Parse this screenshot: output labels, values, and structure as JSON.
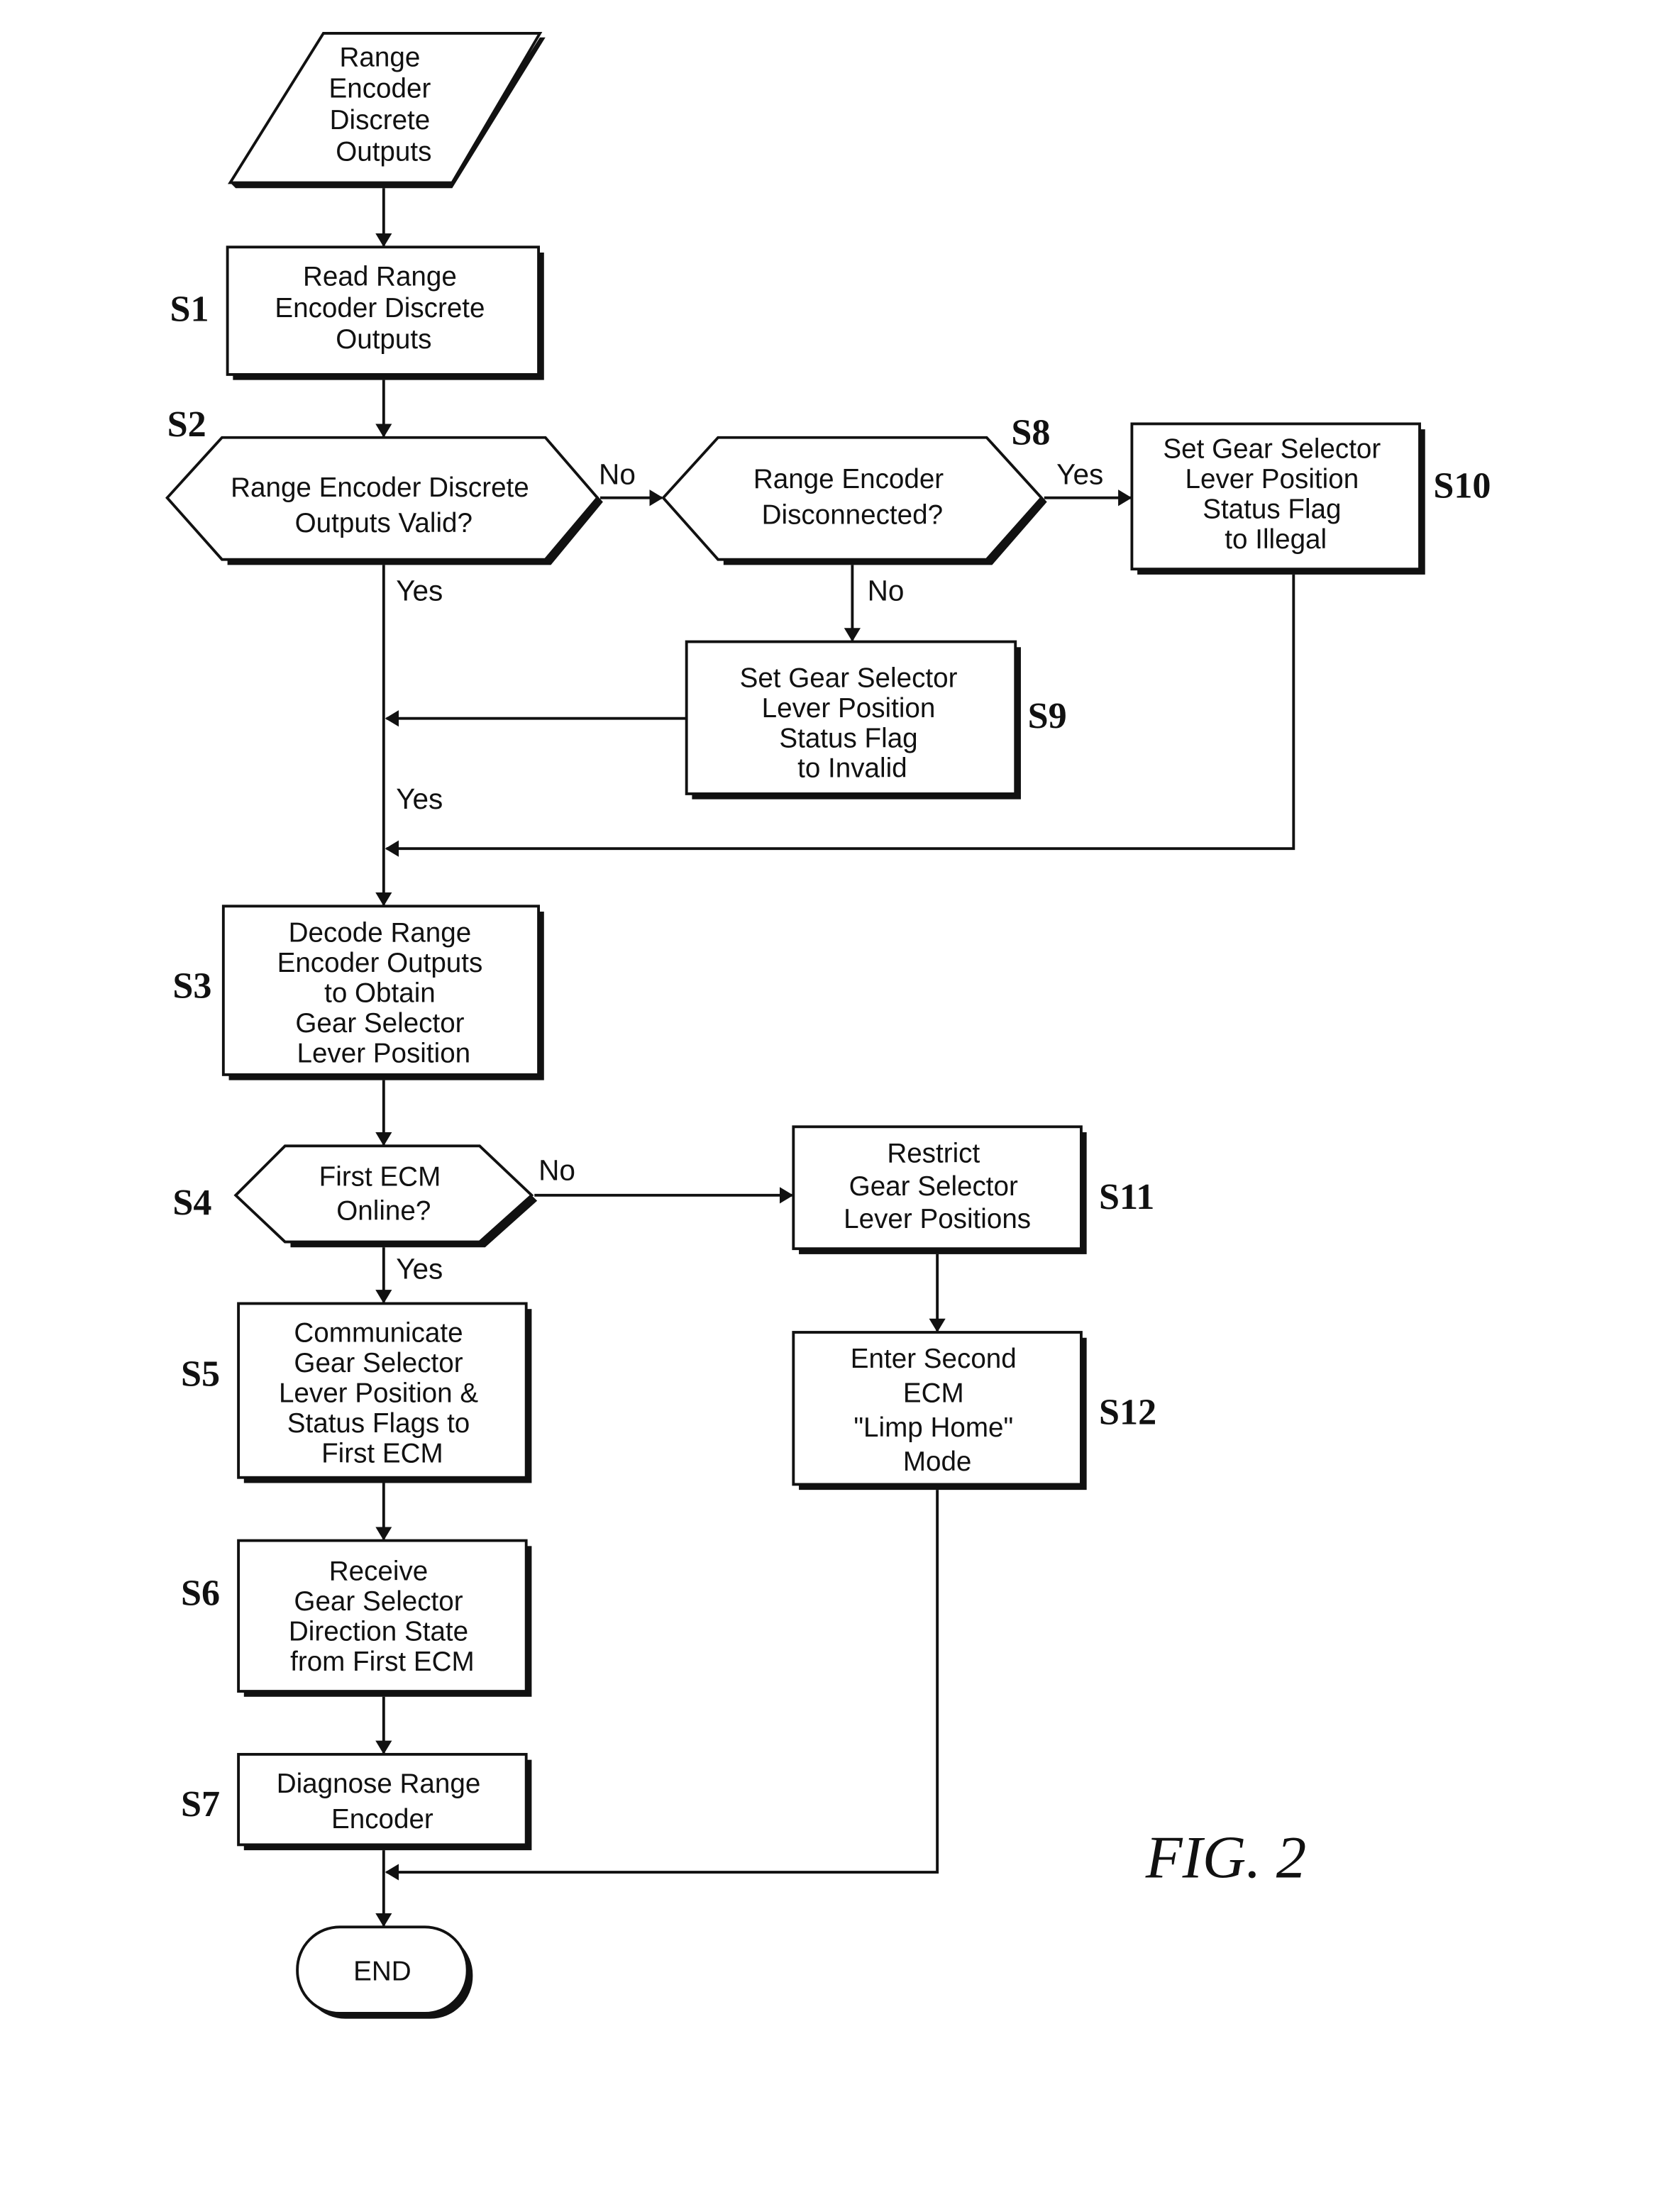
{
  "figure_label": "FIG. 2",
  "nodes": {
    "input": {
      "lines": [
        "Range",
        "Encoder",
        "Discrete",
        "Outputs"
      ]
    },
    "s1": {
      "step": "S1",
      "lines": [
        "Read Range",
        "Encoder Discrete",
        "Outputs"
      ]
    },
    "s2": {
      "step": "S2",
      "lines": [
        "Range Encoder Discrete",
        "Outputs Valid?"
      ]
    },
    "s3": {
      "step": "S3",
      "lines": [
        "Decode Range",
        "Encoder Outputs",
        "to Obtain",
        "Gear Selector",
        "Lever Position"
      ]
    },
    "s4": {
      "step": "S4",
      "lines": [
        "First ECM",
        "Online?"
      ]
    },
    "s5": {
      "step": "S5",
      "lines": [
        "Communicate",
        "Gear Selector",
        "Lever Position &",
        "Status Flags to",
        "First ECM"
      ]
    },
    "s6": {
      "step": "S6",
      "lines": [
        "Receive",
        "Gear Selector",
        "Direction State",
        "from First ECM"
      ]
    },
    "s7": {
      "step": "S7",
      "lines": [
        "Diagnose Range",
        "Encoder"
      ]
    },
    "s8": {
      "step": "S8",
      "lines": [
        "Range Encoder",
        "Disconnected?"
      ]
    },
    "s9": {
      "step": "S9",
      "lines": [
        "Set Gear Selector",
        "Lever Position",
        "Status Flag",
        "to Invalid"
      ]
    },
    "s10": {
      "step": "S10",
      "lines": [
        "Set Gear Selector",
        "Lever Position",
        "Status Flag",
        "to Illegal"
      ]
    },
    "s11": {
      "step": "S11",
      "lines": [
        "Restrict",
        "Gear Selector",
        "Lever Positions"
      ]
    },
    "s12": {
      "step": "S12",
      "lines": [
        "Enter Second",
        "ECM",
        "\"Limp Home\"",
        "Mode"
      ]
    },
    "end": {
      "lines": [
        "END"
      ]
    }
  },
  "edge_labels": {
    "s2_no": "No",
    "s2_yes": "Yes",
    "s8_yes": "Yes",
    "s8_no": "No",
    "merge_yes": "Yes",
    "s4_no": "No",
    "s4_yes": "Yes"
  }
}
